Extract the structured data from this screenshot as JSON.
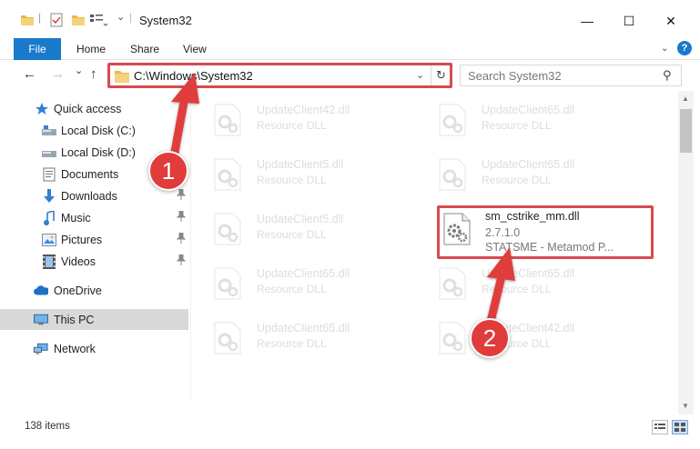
{
  "window": {
    "title": "System32",
    "minimize_glyph": "—",
    "maximize_glyph": "☐",
    "close_glyph": "✕"
  },
  "ribbon": {
    "file": "File",
    "home": "Home",
    "share": "Share",
    "view": "View",
    "collapse_glyph": "⌄",
    "help_glyph": "?"
  },
  "nav": {
    "back_glyph": "←",
    "forward_glyph": "→",
    "recent_glyph": "⌄",
    "up_glyph": "↑",
    "address_path": "C:\\Windows\\System32",
    "address_dropdown_glyph": "⌄",
    "refresh_glyph": "↻",
    "search_placeholder": "Search System32",
    "search_glyph": "⚲"
  },
  "sidebar": {
    "items": [
      {
        "label": "Quick access",
        "icon": "star-icon"
      },
      {
        "label": "Local Disk (C:)",
        "icon": "drive-icon"
      },
      {
        "label": "Local Disk (D:)",
        "icon": "drive-icon"
      },
      {
        "label": "Documents",
        "icon": "documents-icon",
        "pinned": true
      },
      {
        "label": "Downloads",
        "icon": "download-icon",
        "pinned": true
      },
      {
        "label": "Music",
        "icon": "music-icon",
        "pinned": true
      },
      {
        "label": "Pictures",
        "icon": "pictures-icon",
        "pinned": true
      },
      {
        "label": "Videos",
        "icon": "videos-icon",
        "pinned": true
      },
      {
        "label": "OneDrive",
        "icon": "cloud-icon"
      },
      {
        "label": "This PC",
        "icon": "monitor-icon",
        "selected": true
      },
      {
        "label": "Network",
        "icon": "network-icon"
      }
    ],
    "pin_glyph": "📌"
  },
  "files": [
    {
      "name": "UpdateClient42.dll",
      "desc": "Resource DLL"
    },
    {
      "name": "UpdateClient65.dll",
      "desc": "Resource DLL"
    },
    {
      "name": "UpdateClient5.dll",
      "desc": "Resource DLL"
    },
    {
      "name": "UpdateClient65.dll",
      "desc": "Resource DLL"
    },
    {
      "name": "UpdateClient5.dll",
      "desc": "Resource DLL"
    },
    {
      "name": "UpdateClient65.dll",
      "desc": "Resource DLL"
    },
    {
      "name": "UpdateClient65.dll",
      "desc": "Resource DLL"
    },
    {
      "name": "UpdateClient65.dll",
      "desc": "Resource DLL"
    },
    {
      "name": "UpdateClient42.dll",
      "desc": "Resource DLL"
    }
  ],
  "highlighted_file": {
    "name": "sm_cstrike_mm.dll",
    "version": "2.7.1.0",
    "company": "STATSME - Metamod P..."
  },
  "status": {
    "count": "138 items"
  },
  "annotations": {
    "step1": "1",
    "step2": "2",
    "accent_color": "#d84a4f"
  }
}
